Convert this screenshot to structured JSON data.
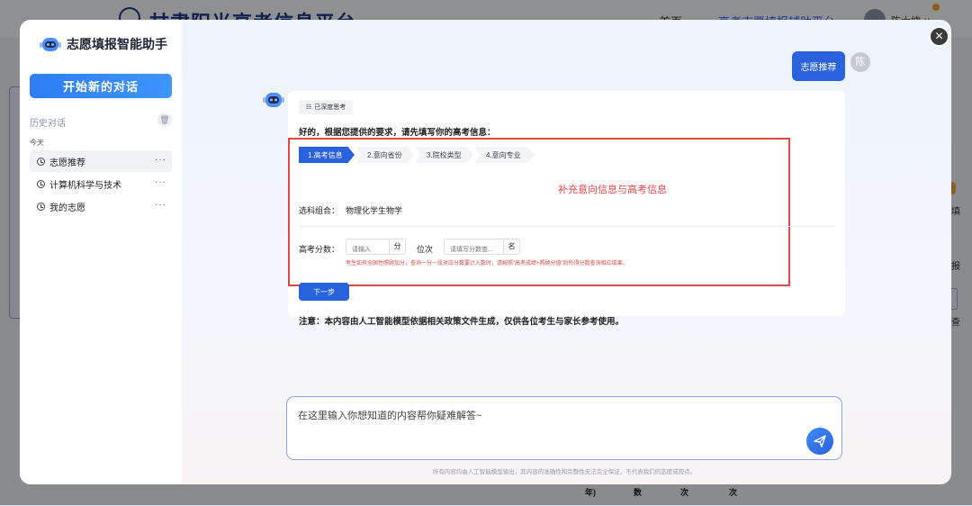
{
  "background": {
    "site_title": "甘肃阳光高考信息平台",
    "nav_home": "首页",
    "nav_active": "高考志愿填报辅助平台",
    "user_name": "陈大婕 ∨",
    "right_label_a": "填",
    "right_label_b": "报",
    "right_label_c": "查",
    "table_cells": [
      "年)",
      "数",
      "次",
      "次"
    ]
  },
  "sidebar": {
    "brand": "志愿填报智能助手",
    "new_chat": "开始新的对话",
    "history_title": "历史对话",
    "today": "今天",
    "items": [
      {
        "label": "志愿推荐",
        "more": "···"
      },
      {
        "label": "计算机科学与技术",
        "more": "···"
      },
      {
        "label": "我的志愿",
        "more": "···"
      }
    ]
  },
  "chat": {
    "user_message": "志愿推荐",
    "user_avatar": "陈",
    "think_badge": "已深度思考",
    "intro": "好的，根据您提供的要求，请先填写你的高考信息：",
    "steps": [
      "1.高考信息",
      "2.意向省份",
      "3.院校类型",
      "4.意向专业"
    ],
    "annotation": "补充意向信息与高考信息",
    "subject_label": "选科组合：",
    "subject_value": "物理化学生物学",
    "score_label": "高考分数：",
    "score_placeholder": "请输入",
    "score_unit": "分",
    "rank_label": "位次",
    "rank_placeholder": "请填写分数查...",
    "rank_unit": "名",
    "hint": "考生如有全国性照顾加分，查询一分一段对应分数要计入数时，请按照“高考成绩+照顾分值”后所得分数查询相应结果。",
    "next_button": "下一步",
    "notice": "注意：本内容由人工智能模型依据相关政策文件生成，仅供各位考生与家长参考使用。"
  },
  "input": {
    "placeholder": "在这里输入你想知道的内容帮你疑难解答~",
    "disclaimer": "所有内容均由人工智能模型输出，其内容的准确性和完整性无法完全保证，不代表我们的态度或观点。"
  },
  "colors": {
    "primary": "#2a61dc",
    "highlight_red": "#e04848"
  },
  "icons": {
    "close": "close-icon",
    "send": "send-icon",
    "trash": "trash-icon",
    "clock": "clock-icon",
    "robot": "robot-icon"
  }
}
